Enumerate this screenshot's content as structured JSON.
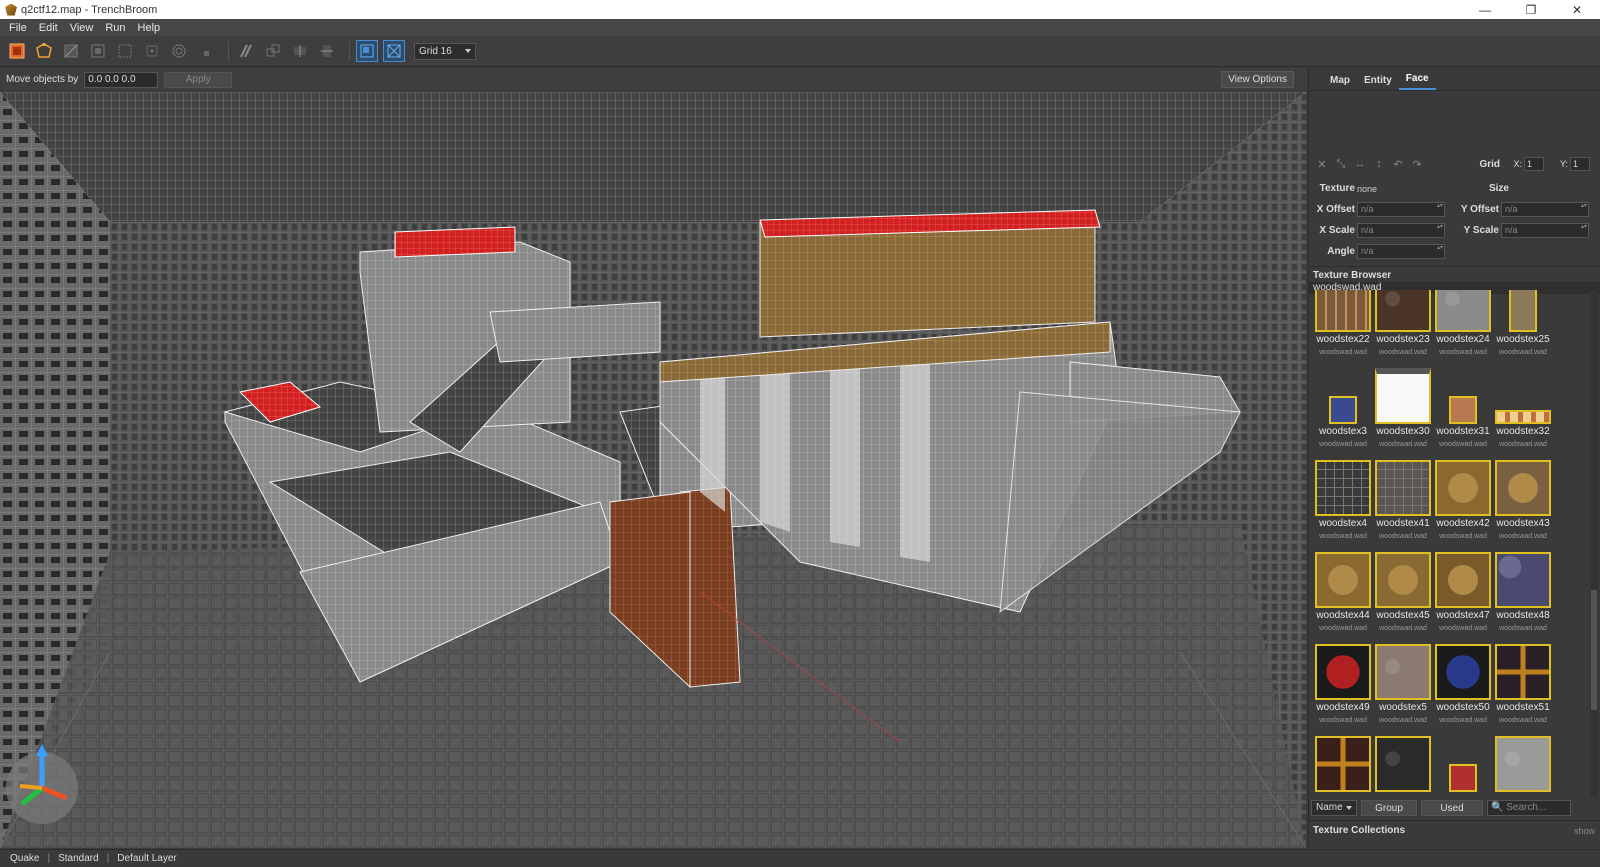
{
  "window": {
    "title": "q2ctf12.map - TrenchBroom"
  },
  "menu": [
    "File",
    "Edit",
    "View",
    "Run",
    "Help"
  ],
  "toolbar": {
    "grid_value": "Grid 16"
  },
  "movebar": {
    "label": "Move objects by",
    "value": "0.0 0.0 0.0",
    "apply": "Apply",
    "view_options": "View Options"
  },
  "inspector": {
    "tabs": [
      "Map",
      "Entity",
      "Face"
    ],
    "active_tab": "Face",
    "grid_label": "Grid",
    "grid_x_label": "X:",
    "grid_x": "1",
    "grid_y_label": "Y:",
    "grid_y": "1",
    "texture_label": "Texture",
    "texture_value": "none",
    "size_label": "Size",
    "x_offset_label": "X Offset",
    "y_offset_label": "Y Offset",
    "x_scale_label": "X Scale",
    "y_scale_label": "Y Scale",
    "angle_label": "Angle",
    "na": "n/a"
  },
  "texture_browser": {
    "header": "Texture Browser",
    "wad": "woodswad.wad",
    "wad_short": "woodswad.wad",
    "textures": [
      {
        "name": "woodstex22",
        "color": "#7a5a3a",
        "pattern": "stripes"
      },
      {
        "name": "woodstex23",
        "color": "#4a3428",
        "pattern": "rough"
      },
      {
        "name": "woodstex24",
        "color": "#8a8a88",
        "pattern": "rough"
      },
      {
        "name": "woodstex25",
        "color": "#8c7a5a",
        "pattern": "narrow"
      },
      {
        "name": "woodstex3",
        "color": "#3a4a90",
        "pattern": "small"
      },
      {
        "name": "woodstex30",
        "color": "#f4f4f4",
        "pattern": "white"
      },
      {
        "name": "woodstex31",
        "color": "#b87850",
        "pattern": "smallwarm"
      },
      {
        "name": "woodstex32",
        "color": "#c07040",
        "pattern": "lights"
      },
      {
        "name": "woodstex4",
        "color": "#3a3a3a",
        "pattern": "grid"
      },
      {
        "name": "woodstex41",
        "color": "#5a5452",
        "pattern": "grid"
      },
      {
        "name": "woodstex42",
        "color": "#8a6830",
        "pattern": "panel"
      },
      {
        "name": "woodstex43",
        "color": "#7a6040",
        "pattern": "panel"
      },
      {
        "name": "woodstex44",
        "color": "#8a6a30",
        "pattern": "frame"
      },
      {
        "name": "woodstex45",
        "color": "#8a6a34",
        "pattern": "frame"
      },
      {
        "name": "woodstex47",
        "color": "#7a5a2a",
        "pattern": "frame"
      },
      {
        "name": "woodstex48",
        "color": "#4a4a70",
        "pattern": "hex"
      },
      {
        "name": "woodstex49",
        "color": "#b02020",
        "pattern": "logo"
      },
      {
        "name": "woodstex5",
        "color": "#8a7a70",
        "pattern": "rough"
      },
      {
        "name": "woodstex50",
        "color": "#2a3a8a",
        "pattern": "logo"
      },
      {
        "name": "woodstex51",
        "color": "#2a2028",
        "pattern": "cross"
      },
      {
        "name": "",
        "color": "#3a2018",
        "pattern": "cross"
      },
      {
        "name": "",
        "color": "#2a2a2a",
        "pattern": "rough"
      },
      {
        "name": "",
        "color": "#b03030",
        "pattern": "small"
      },
      {
        "name": "",
        "color": "#9a9a98",
        "pattern": "rough"
      }
    ],
    "sort": "Name",
    "group": "Group",
    "used": "Used",
    "search_placeholder": "Search...",
    "collections": "Texture Collections",
    "show": "show"
  },
  "status": [
    "Quake",
    "Standard",
    "Default Layer"
  ]
}
